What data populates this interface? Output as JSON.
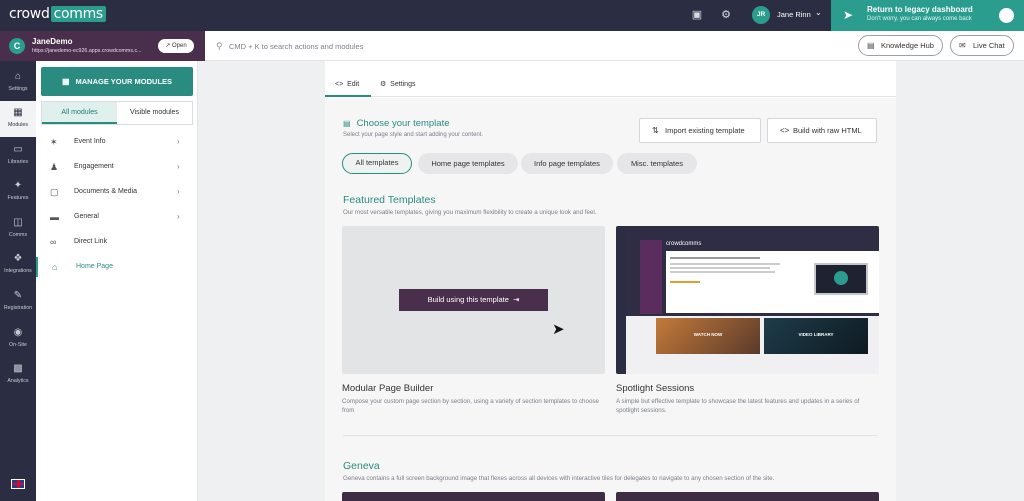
{
  "topbar": {
    "logo_text": "crowd",
    "logo_accent": "comms",
    "user_initials": "JR",
    "user_name": "Jane Rinn",
    "legacy_title": "Return to legacy dashboard",
    "legacy_subtitle": "Don't worry, you can always come back"
  },
  "site": {
    "name": "JaneDemo",
    "url": "https://janedemo-ec926.apps.crowdcomms.c...",
    "open_label": "Open"
  },
  "search": {
    "placeholder": "CMD + K to search actions and modules"
  },
  "help": {
    "knowledge_hub": "Knowledge Hub",
    "live_chat": "Live Chat"
  },
  "rail": [
    {
      "label": "Settings",
      "icon": "home-icon"
    },
    {
      "label": "Modules",
      "icon": "grid-icon"
    },
    {
      "label": "Libraries",
      "icon": "folder-icon"
    },
    {
      "label": "Features",
      "icon": "sparkle-icon"
    },
    {
      "label": "Comms",
      "icon": "comms-icon"
    },
    {
      "label": "Integrations",
      "icon": "puzzle-icon"
    },
    {
      "label": "Registration",
      "icon": "registration-icon"
    },
    {
      "label": "On-Site",
      "icon": "onsite-icon"
    },
    {
      "label": "Analytics",
      "icon": "chart-icon"
    }
  ],
  "modules": {
    "manage_label": "MANAGE YOUR MODULES",
    "tab_all": "All modules",
    "tab_visible": "Visible modules",
    "items": [
      {
        "label": "Event Info",
        "icon": "party-icon",
        "has_children": true
      },
      {
        "label": "Engagement",
        "icon": "people-icon",
        "has_children": true
      },
      {
        "label": "Documents & Media",
        "icon": "documents-icon",
        "has_children": true
      },
      {
        "label": "General",
        "icon": "folder-icon",
        "has_children": true
      },
      {
        "label": "Direct Link",
        "icon": "link-icon",
        "has_children": false
      },
      {
        "label": "Home Page",
        "icon": "home-icon",
        "has_children": false
      }
    ]
  },
  "editor": {
    "tab_edit": "Edit",
    "tab_settings": "Settings",
    "choose_title": "Choose your template",
    "choose_subtitle": "Select your page style and start adding your content.",
    "import_label": "Import existing template",
    "raw_html_label": "Build with raw HTML",
    "filters": [
      "All templates",
      "Home page templates",
      "Info page templates",
      "Misc. templates"
    ],
    "featured_title": "Featured Templates",
    "featured_subtitle": "Our most versatile templates, giving you maximum flexibility to create a unique look and feel.",
    "build_label": "Build using this template",
    "templates": [
      {
        "name": "Modular Page Builder",
        "description": "Compose your custom page section by section, using a variety of section templates to choose from"
      },
      {
        "name": "Spotlight Sessions",
        "description": "A simple but effective template to showcase the latest features and updates in a series of spotlight sessions."
      }
    ],
    "spotlight_preview": {
      "logo": "crowdcomms",
      "tile1": "WATCH NOW",
      "tile2": "VIDEO LIBRARY"
    },
    "geneva_title": "Geneva",
    "geneva_subtitle": "Geneva contains a full screen background image that flexes across all devices with interactive tiles for delegates to navigate to any chosen section of the site."
  },
  "colors": {
    "accent": "#2a8c80",
    "nav": "#2b2d42",
    "brand_purple": "#4a2f4d"
  }
}
